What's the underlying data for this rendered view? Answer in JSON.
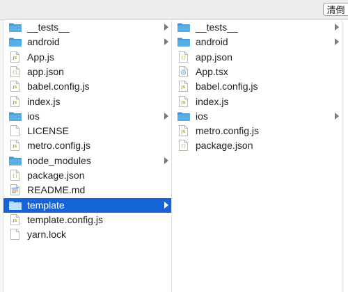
{
  "toolbar": {
    "button_label": "清倒"
  },
  "columns": [
    {
      "items": [
        {
          "label": "__tests__",
          "icon": "folder-icon",
          "folder": true
        },
        {
          "label": "android",
          "icon": "folder-icon",
          "folder": true
        },
        {
          "label": "App.js",
          "icon": "js-file-icon",
          "folder": false
        },
        {
          "label": "app.json",
          "icon": "json-file-icon",
          "folder": false
        },
        {
          "label": "babel.config.js",
          "icon": "js-file-icon",
          "folder": false
        },
        {
          "label": "index.js",
          "icon": "js-file-icon",
          "folder": false
        },
        {
          "label": "ios",
          "icon": "folder-icon",
          "folder": true
        },
        {
          "label": "LICENSE",
          "icon": "blank-document-icon",
          "folder": false
        },
        {
          "label": "metro.config.js",
          "icon": "js-file-icon",
          "folder": false
        },
        {
          "label": "node_modules",
          "icon": "folder-icon",
          "folder": true
        },
        {
          "label": "package.json",
          "icon": "json-file-icon",
          "folder": false
        },
        {
          "label": "README.md",
          "icon": "markdown-document-icon",
          "folder": false
        },
        {
          "label": "template",
          "icon": "folder-icon",
          "folder": true,
          "selected": true
        },
        {
          "label": "template.config.js",
          "icon": "js-file-icon",
          "folder": false
        },
        {
          "label": "yarn.lock",
          "icon": "blank-document-icon",
          "folder": false
        }
      ]
    },
    {
      "items": [
        {
          "label": "__tests__",
          "icon": "folder-icon",
          "folder": true
        },
        {
          "label": "android",
          "icon": "folder-icon",
          "folder": true
        },
        {
          "label": "app.json",
          "icon": "json-file-icon",
          "folder": false
        },
        {
          "label": "App.tsx",
          "icon": "ts-file-icon",
          "folder": false
        },
        {
          "label": "babel.config.js",
          "icon": "js-file-icon",
          "folder": false
        },
        {
          "label": "index.js",
          "icon": "js-file-icon",
          "folder": false
        },
        {
          "label": "ios",
          "icon": "folder-icon",
          "folder": true
        },
        {
          "label": "metro.config.js",
          "icon": "js-file-icon",
          "folder": false
        },
        {
          "label": "package.json",
          "icon": "json-file-icon",
          "folder": false
        }
      ]
    }
  ],
  "colors": {
    "selection": "#1565d8",
    "folder": "#5aaee8",
    "folder_dark": "#3f95d6"
  }
}
